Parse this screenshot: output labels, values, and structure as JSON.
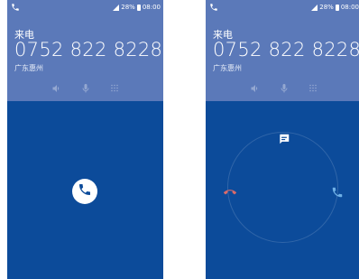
{
  "status": {
    "battery": "28%",
    "time": "08:00"
  },
  "call": {
    "label": "来电",
    "number": "0752 822 8228",
    "location": "广东惠州"
  },
  "colors": {
    "header": "#5b79b9",
    "body": "#0c4b9a",
    "accent": "#ffffff"
  },
  "icons": [
    "phone-icon",
    "speaker-icon",
    "mute-icon",
    "keypad-icon",
    "answer-icon",
    "message-icon",
    "decline-icon"
  ]
}
